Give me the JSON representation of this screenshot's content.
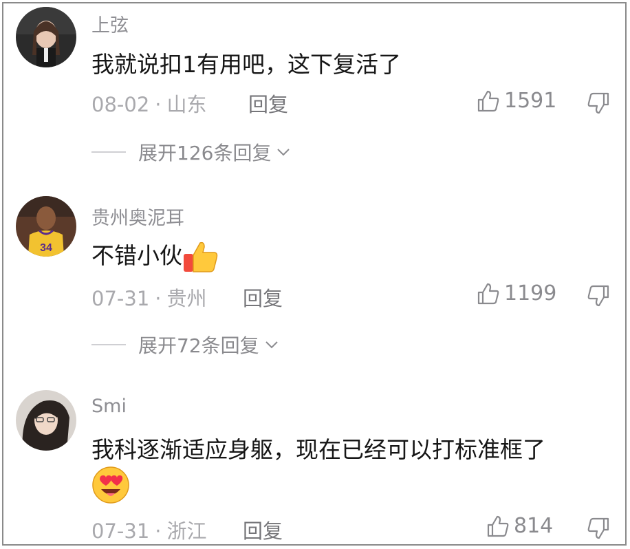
{
  "comments": [
    {
      "username": "上弦",
      "text": "我就说扣1有用吧，这下复活了",
      "date": "08-02",
      "location": "山东",
      "reply_label": "回复",
      "likes": "1591",
      "expand_label": "展开126条回复"
    },
    {
      "username": "贵州奥泥耳",
      "text": "不错小伙",
      "date": "07-31",
      "location": "贵州",
      "reply_label": "回复",
      "likes": "1199",
      "expand_label": "展开72条回复",
      "avatar_jersey_number": "34"
    },
    {
      "username": "Smi",
      "text": "我科逐渐适应身躯，现在已经可以打标准框了",
      "date": "07-31",
      "location": "浙江",
      "reply_label": "回复",
      "likes": "814"
    }
  ],
  "separator": "·",
  "icons": [
    "thumbs-up-icon",
    "thumbs-down-icon",
    "chevron-down-icon",
    "thumbs-up-emoji",
    "heart-eyes-emoji"
  ],
  "colors": {
    "text": "#161616",
    "muted": "#a9a9ad",
    "username": "#8e8e93"
  }
}
